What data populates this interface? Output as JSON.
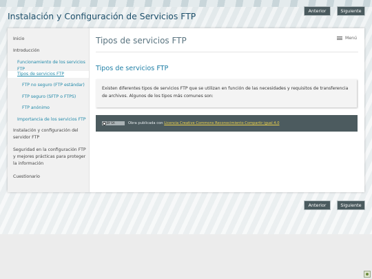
{
  "site_title": "Instalación y Configuración de Servicios FTP",
  "nav": {
    "prev_label": "Anterior",
    "next_label": "Siguiente"
  },
  "sidebar": {
    "items": [
      {
        "label": "Inicio",
        "level": 0
      },
      {
        "label": "Introducción",
        "level": 0
      },
      {
        "label": "Funcionamiento de los servicios FTP",
        "level": 1
      },
      {
        "label": "Tipos de servicios FTP",
        "level": 1,
        "active": true
      },
      {
        "label": "FTP no seguro (FTP estándar)",
        "level": 2
      },
      {
        "label": "FTP seguro (SFTP o FTPS)",
        "level": 2
      },
      {
        "label": "FTP anónimo",
        "level": 2
      },
      {
        "label": "Importancia de los servicios FTP",
        "level": 1
      },
      {
        "label": "Instalación y configuración del servidor FTP",
        "level": 0
      },
      {
        "label": "Seguridad en la configuración FTP y mejores prácticas para proteger la información",
        "level": 0
      },
      {
        "label": "Cuestionario",
        "level": 0
      }
    ]
  },
  "content": {
    "page_title": "Tipos de servicios FTP",
    "menu_label": "Menú",
    "section_title": "Tipos de servicios FTP",
    "body_text": "Existen diferentes tipos de servicios FTP que se utilizan en función de las necesidades y requisitos de transferencia de archivos. Algunos de los tipos más comunes son:"
  },
  "license": {
    "badge_text": "BY SA",
    "prefix": "Obra publicada con ",
    "link_text": "Licencia Creative Commons Reconocimiento Compartir igual 4.0"
  },
  "icons": [
    "menu-icon",
    "cc-license-icon",
    "help-icon"
  ],
  "colors": {
    "title": "#1d4f6a",
    "link": "#1f88a8",
    "button_bg": "#4a5a5e",
    "license_bg": "#4c5b5f"
  }
}
